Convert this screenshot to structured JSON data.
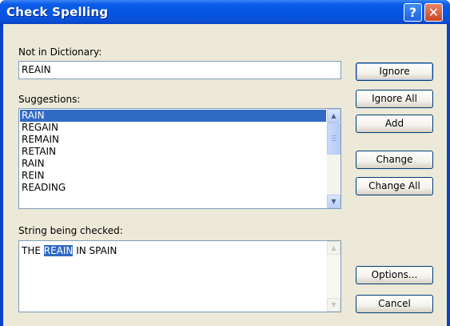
{
  "window": {
    "title": "Check Spelling"
  },
  "titlebar": {
    "help_glyph": "?",
    "close_glyph": "✕"
  },
  "not_in_dictionary": {
    "label": "Not in Dictionary:",
    "value": "REAIN"
  },
  "suggestions": {
    "label": "Suggestions:",
    "items": [
      "RAIN",
      "REGAIN",
      "REMAIN",
      "RETAIN",
      "RAIN",
      "REIN",
      "READING"
    ],
    "selected_index": 0
  },
  "string_checked": {
    "label": "String being checked:",
    "before": "THE ",
    "highlight": "REAIN",
    "after": " IN SPAIN"
  },
  "buttons": {
    "ignore": "Ignore",
    "ignore_all": "Ignore All",
    "add": "Add",
    "change": "Change",
    "change_all": "Change All",
    "options": "Options...",
    "cancel": "Cancel"
  },
  "icons": {
    "scroll_up": "▲",
    "scroll_down": "▼"
  },
  "colors": {
    "title_bar": "#0554e3",
    "selection": "#316ac5",
    "dialog_face": "#ece9d8",
    "close_button": "#c94422"
  }
}
